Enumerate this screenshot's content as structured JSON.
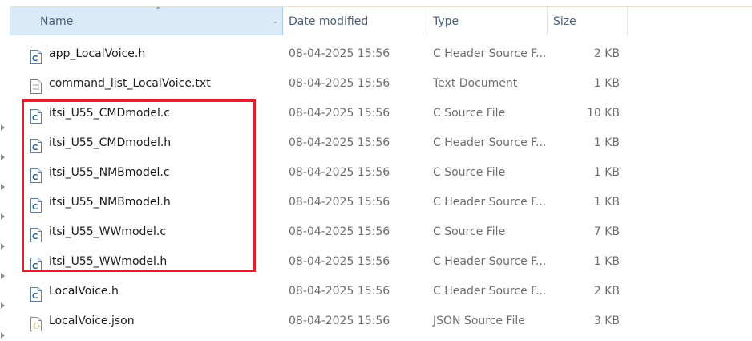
{
  "columns": {
    "name": "Name",
    "date_modified": "Date modified",
    "type": "Type",
    "size": "Size"
  },
  "files": [
    {
      "name": "app_LocalVoice.h",
      "date": "08-04-2025 15:56",
      "type": "C Header Source F...",
      "size": "2 KB",
      "icon": "c-header-file-icon"
    },
    {
      "name": "command_list_LocalVoice.txt",
      "date": "08-04-2025 15:56",
      "type": "Text Document",
      "size": "1 KB",
      "icon": "text-document-icon"
    },
    {
      "name": "itsi_U55_CMDmodel.c",
      "date": "08-04-2025 15:56",
      "type": "C Source File",
      "size": "10 KB",
      "icon": "c-source-file-icon"
    },
    {
      "name": "itsi_U55_CMDmodel.h",
      "date": "08-04-2025 15:56",
      "type": "C Header Source F...",
      "size": "1 KB",
      "icon": "c-header-file-icon"
    },
    {
      "name": "itsi_U55_NMBmodel.c",
      "date": "08-04-2025 15:56",
      "type": "C Source File",
      "size": "1 KB",
      "icon": "c-source-file-icon"
    },
    {
      "name": "itsi_U55_NMBmodel.h",
      "date": "08-04-2025 15:56",
      "type": "C Header Source F...",
      "size": "1 KB",
      "icon": "c-header-file-icon"
    },
    {
      "name": "itsi_U55_WWmodel.c",
      "date": "08-04-2025 15:56",
      "type": "C Source File",
      "size": "7 KB",
      "icon": "c-source-file-icon"
    },
    {
      "name": "itsi_U55_WWmodel.h",
      "date": "08-04-2025 15:56",
      "type": "C Header Source F...",
      "size": "1 KB",
      "icon": "c-header-file-icon"
    },
    {
      "name": "LocalVoice.h",
      "date": "08-04-2025 15:56",
      "type": "C Header Source F...",
      "size": "2 KB",
      "icon": "c-header-file-icon"
    },
    {
      "name": "LocalVoice.json",
      "date": "08-04-2025 15:56",
      "type": "JSON Source File",
      "size": "3 KB",
      "icon": "json-file-icon"
    }
  ],
  "sort": {
    "column": "name",
    "direction": "ascending"
  },
  "colors": {
    "highlight": "#e0212b",
    "header_active": "#d9ebf9"
  }
}
